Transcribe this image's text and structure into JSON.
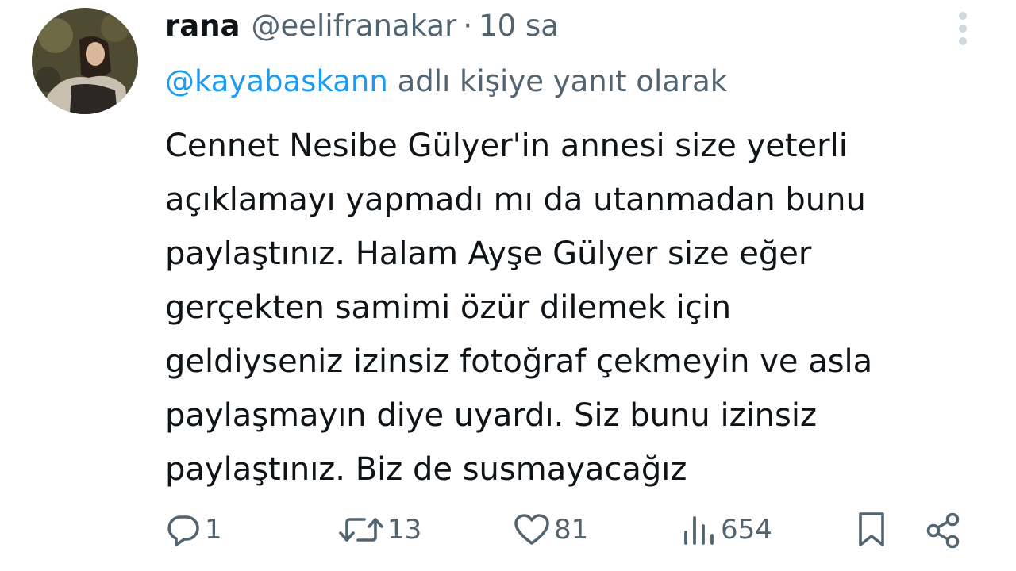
{
  "tweet": {
    "display_name": "rana",
    "handle": "@eelifranakar",
    "separator": "·",
    "time": "10 sa",
    "reply_mention": "@kayabaskann",
    "reply_suffix": " adlı kişiye yanıt olarak",
    "body_text": "Cennet Nesibe Gülyer'in annesi size yeterli\naçıklamayı yapmadı mı da utanmadan bunu\npaylaştınız. Halam Ayşe Gülyer size eğer\ngerçekten samimi özür dilemek için\ngeldiyseniz izinsiz fotoğraf çekmeyin ve asla\npaylaşmayın diye uyardı. Siz bunu izinsiz\npaylaştınız. Biz de susmayacağız"
  },
  "actions": {
    "reply": {
      "icon": "reply-icon",
      "count": "1"
    },
    "retweet": {
      "icon": "retweet-icon",
      "count": "13"
    },
    "like": {
      "icon": "heart-icon",
      "count": "81"
    },
    "views": {
      "icon": "views-icon",
      "count": "654"
    },
    "bookmark": {
      "icon": "bookmark-icon"
    },
    "share": {
      "icon": "share-icon"
    }
  },
  "colors": {
    "text": "#0f1419",
    "secondary": "#536471",
    "accent": "#1d9bf0",
    "more_dots": "#cfd9de"
  }
}
